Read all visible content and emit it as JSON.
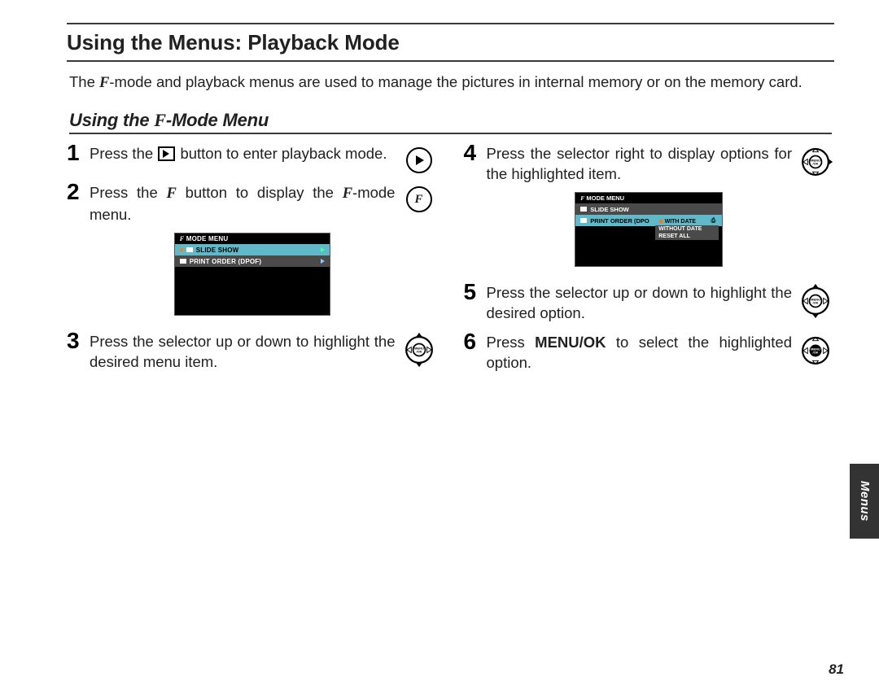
{
  "header": {
    "title": "Using the Menus: Playback Mode"
  },
  "intro": {
    "before_f": "The ",
    "after_f": "-mode and playback menus are used to manage the pictures in internal memory or on the memory card."
  },
  "subheader": {
    "prefix": "Using the ",
    "suffix": "-Mode Menu"
  },
  "glyph": {
    "f": "F"
  },
  "steps": [
    {
      "n": "1",
      "before": "Press the ",
      "after": " button to enter playback mode.",
      "inline_icon": "playback",
      "illus": "play_ring"
    },
    {
      "n": "2",
      "before": "Press the ",
      "mid_f": true,
      "after": " button to display the ",
      "tail_f": true,
      "tail_after": "-mode menu.",
      "illus": "f_ring",
      "lcd": 1
    },
    {
      "n": "3",
      "text": "Press the selector up or down to highlight the desired menu item.",
      "illus": "pad_ud"
    },
    {
      "n": "4",
      "text": "Press the selector right to display options for the highlighted item.",
      "illus": "pad_r",
      "lcd": 2
    },
    {
      "n": "5",
      "text": "Press the selector up or down to highlight the desired option.",
      "illus": "pad_ud2"
    },
    {
      "n": "6",
      "before": "Press ",
      "bold": "MENU/OK",
      "after": " to select the highlighted option.",
      "illus": "pad_center"
    }
  ],
  "lcd": {
    "title": "MODE MENU",
    "slide": "SLIDE SHOW",
    "print": "PRINT ORDER (DPOF)",
    "print_short": "PRINT ORDER (DPO",
    "sub": {
      "withdate": "WITH DATE",
      "without": "WITHOUT DATE",
      "reset": "RESET ALL"
    }
  },
  "sidetab": "Menus",
  "page_number": "81",
  "selector_label": {
    "top": "MENU",
    "bottom": "/OK"
  }
}
